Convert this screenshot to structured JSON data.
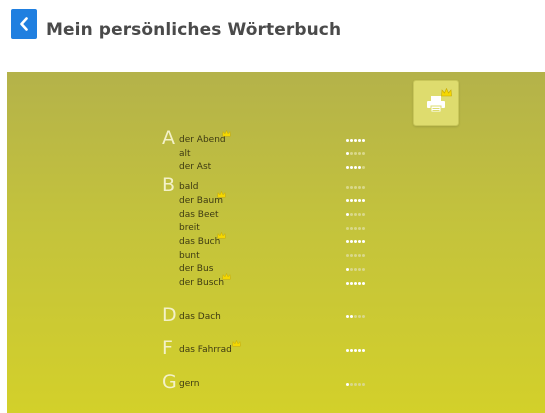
{
  "header": {
    "title": "Mein persönliches Wörterbuch",
    "back_icon": "chevron-left-icon",
    "accent": "#1f7fe0"
  },
  "toolbar": {
    "print_icon": "printer-icon",
    "crown_icon": "crown-icon"
  },
  "dictionary": {
    "background_top": "#b4b24a",
    "background_bottom": "#d3d02a",
    "sections": [
      {
        "letter": "A",
        "entries": [
          {
            "word": "der Abend",
            "level": 5,
            "crown": true
          },
          {
            "word": "alt",
            "level": 1,
            "crown": false
          },
          {
            "word": "der Ast",
            "level": 4,
            "crown": false
          }
        ]
      },
      {
        "letter": "B",
        "entries": [
          {
            "word": "bald",
            "level": 0,
            "crown": false
          },
          {
            "word": "der Baum",
            "level": 5,
            "crown": true
          },
          {
            "word": "das Beet",
            "level": 1,
            "crown": false
          },
          {
            "word": "breit",
            "level": 0,
            "crown": false
          },
          {
            "word": "das Buch",
            "level": 5,
            "crown": true
          },
          {
            "word": "bunt",
            "level": 0,
            "crown": false
          },
          {
            "word": "der Bus",
            "level": 1,
            "crown": false
          },
          {
            "word": "der Busch",
            "level": 5,
            "crown": true
          }
        ]
      },
      {
        "letter": "D",
        "entries": [
          {
            "word": "das Dach",
            "level": 2,
            "crown": false
          }
        ]
      },
      {
        "letter": "F",
        "entries": [
          {
            "word": "das Fahrrad",
            "level": 5,
            "crown": true
          }
        ]
      },
      {
        "letter": "G",
        "entries": [
          {
            "word": "gern",
            "level": 1,
            "crown": false
          }
        ]
      }
    ]
  }
}
